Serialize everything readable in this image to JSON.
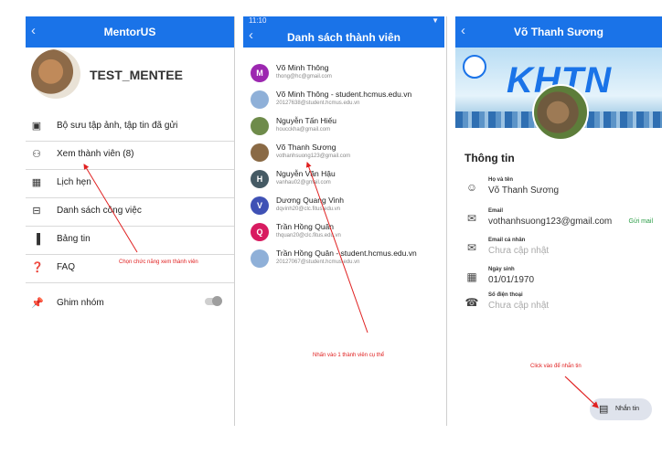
{
  "screen1": {
    "title": "MentorUS",
    "group_name": "TEST_MENTEE",
    "menu": [
      {
        "icon": "gallery-icon",
        "label": "Bộ sưu tập ảnh, tập tin đã gửi"
      },
      {
        "icon": "members-icon",
        "label": "Xem thành viên (8)"
      },
      {
        "icon": "calendar-icon",
        "label": "Lịch hẹn"
      },
      {
        "icon": "task-list-icon",
        "label": "Danh sách công việc"
      },
      {
        "icon": "bulletin-icon",
        "label": "Bảng tin"
      },
      {
        "icon": "faq-icon",
        "label": "FAQ"
      }
    ],
    "pin": {
      "icon": "pin-icon",
      "label": "Ghim nhóm"
    },
    "annotation": "Chọn chức năng xem thành viên"
  },
  "screen2": {
    "status_time": "11:10",
    "title": "Danh sách thành viên",
    "members": [
      {
        "initial": "M",
        "color": "#9c27b0",
        "name": "Võ Minh Thông",
        "email": "thong@hc@gmail.com"
      },
      {
        "initial": "",
        "color": "#8fb0d8",
        "name": "Võ Minh Thông - student.hcmus.edu.vn",
        "email": "20127638@student.hcmus.edu.vn"
      },
      {
        "initial": "",
        "color": "#6e8b4a",
        "name": "Nguyễn Tấn Hiếu",
        "email": "houcckha@gmail.com"
      },
      {
        "initial": "",
        "color": "#8a6a45",
        "name": "Võ Thanh Sương",
        "email": "vothanhsuong123@gmail.com"
      },
      {
        "initial": "H",
        "color": "#455a64",
        "name": "Nguyễn Văn Hậu",
        "email": "vanhau02@gmail.com"
      },
      {
        "initial": "V",
        "color": "#3f51b5",
        "name": "Dương Quang Vinh",
        "email": "dqvinh20@clc.fitus.edu.vn"
      },
      {
        "initial": "Q",
        "color": "#d81b60",
        "name": "Trần Hồng Quân",
        "email": "thquan20@clc.fitus.edu.vn"
      },
      {
        "initial": "",
        "color": "#8fb0d8",
        "name": "Trần Hồng Quân - student.hcmus.edu.vn",
        "email": "20127067@student.hcmus.edu.vn"
      }
    ],
    "annotation": "Nhấn vào 1 thành viên cụ thể"
  },
  "screen3": {
    "title": "Võ Thanh Sương",
    "banner_text": "KHTN",
    "section_title": "Thông tin",
    "fields": [
      {
        "icon": "person-icon",
        "label": "Họ và tên",
        "value": "Võ Thanh Sương",
        "muted": false,
        "action": ""
      },
      {
        "icon": "mail-icon",
        "label": "Email",
        "value": "vothanhsuong123@gmail.com",
        "muted": false,
        "action": "Gửi mail"
      },
      {
        "icon": "mail-icon",
        "label": "Email cá nhân",
        "value": "Chưa cập nhật",
        "muted": true,
        "action": ""
      },
      {
        "icon": "calendar-icon",
        "label": "Ngày sinh",
        "value": "01/01/1970",
        "muted": false,
        "action": ""
      },
      {
        "icon": "phone-icon",
        "label": "Số điện thoại",
        "value": "Chưa cập nhật",
        "muted": true,
        "action": ""
      }
    ],
    "message_button": "Nhắn tin",
    "annotation": "Click vào để nhắn tin"
  },
  "colors": {
    "appbar": "#1a73e8",
    "annotation": "#e02020",
    "send_mail": "#2a9d46"
  }
}
